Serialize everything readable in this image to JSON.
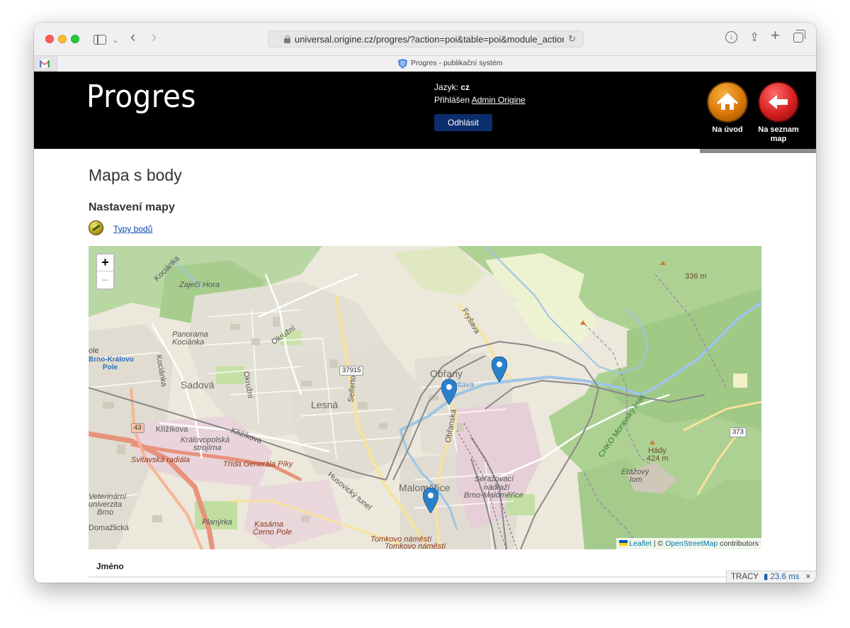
{
  "browser": {
    "url": "universal.origine.cz/progres/?action=poi&table=poi&module_action=edit_",
    "tab_title": "Progres - publikační systém"
  },
  "header": {
    "logo": "Progres",
    "language_label": "Jazyk:",
    "language_value": "cz",
    "logged_label": "Přihlášen",
    "user_name": "Admin Origine",
    "logout_label": "Odhlásit",
    "nav_home_label": "Na úvod",
    "nav_list_label": "Na seznam map"
  },
  "content": {
    "page_title": "Mapa s body",
    "section_title": "Nastavení mapy",
    "point_types_link": "Typy bodů"
  },
  "map": {
    "zoom_in": "+",
    "zoom_out": "−",
    "attribution_leaflet": "Leaflet",
    "attribution_sep": " | © ",
    "attribution_osm": "OpenStreetMap",
    "attribution_suffix": " contributors",
    "labels": {
      "zajeci_hora": "Zaječí Hora",
      "panorama": "Panorama",
      "kocianka": "Kociánka",
      "kralovo_pole_1": "Brno-Královo",
      "kralovo_pole_2": "Pole",
      "ole": "ole",
      "sadova": "Sadová",
      "lesna": "Lesná",
      "obrany": "Obřany",
      "malomerice": "Maloměřice",
      "krizikova": "Křižíkova",
      "krizikova2": "Křižíkova",
      "kralovopolska": "Královopolská",
      "strojirna": "strojírna",
      "svitavska": "Svitavská radiála",
      "trida": "Třída Generála Píky",
      "veterinarni": "Veterinární",
      "univerzita": "univerzita",
      "brno": "Brno",
      "domazlicka": "Domažlická",
      "planyrka": "Planýrka",
      "kasarna": "Kasárna",
      "cerno_pole": "Černo Pole",
      "tomkovo": "Tomkovo náměstí",
      "tomkovo2": "Tomkovo náměstí",
      "serazovaci": "Seřazovací",
      "nadrazi": "nádraží",
      "brno_malomerice": "Brno-Maloměřice",
      "etazovy": "Etážový",
      "lom": "lom",
      "hady": "Hády",
      "hady_height": "424 m",
      "m336": "336 m",
      "okruzni": "Okružní",
      "okruzni2": "Okružní",
      "seifertova": "Seifertova",
      "fryslava": "Fryšava",
      "obranska": "Obřanská",
      "chko": "CHKO Moravský kras",
      "svitava": "Svitava",
      "kocianka_street": "Kociánka",
      "kociankova": "Kociánka",
      "road_37915": "37915",
      "road_43": "43",
      "road_373": "373",
      "hradecky": "Husovický tunel"
    }
  },
  "table": {
    "col_name": "Jméno"
  },
  "tracy": {
    "label": "TRACY",
    "time": "23.6 ms",
    "close": "×"
  }
}
